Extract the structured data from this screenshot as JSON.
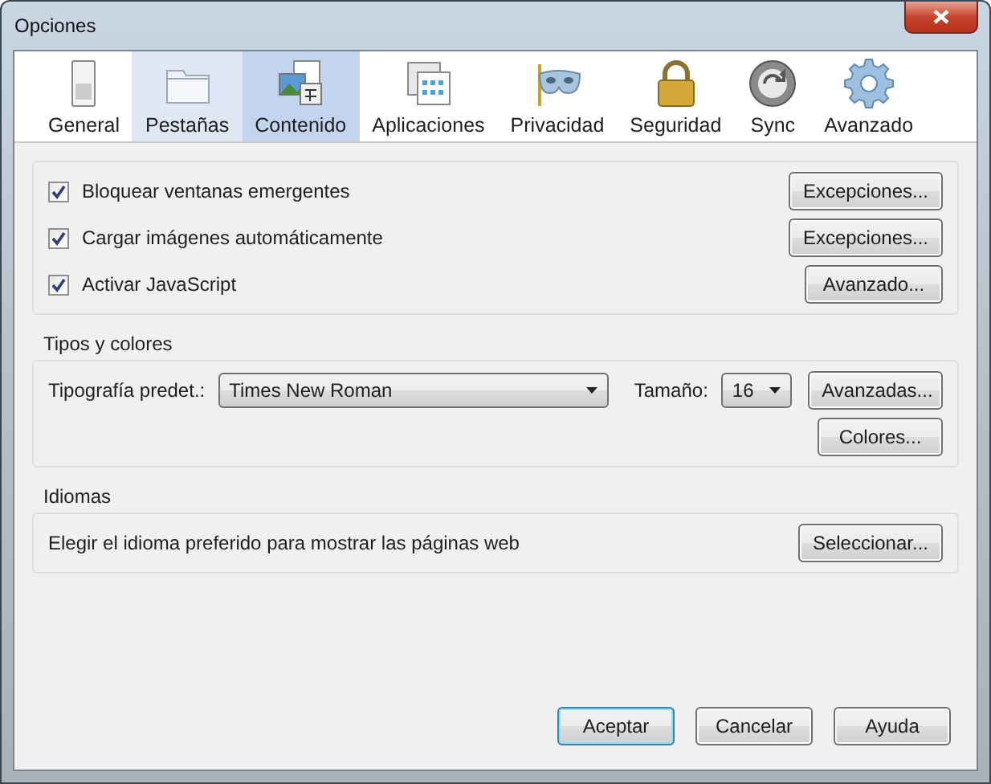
{
  "window": {
    "title": "Opciones"
  },
  "tabs": [
    {
      "label": "General",
      "kind": "switch",
      "selected": false,
      "hovered": false
    },
    {
      "label": "Pestañas",
      "kind": "tabs",
      "selected": false,
      "hovered": true
    },
    {
      "label": "Contenido",
      "kind": "content",
      "selected": true,
      "hovered": false
    },
    {
      "label": "Aplicaciones",
      "kind": "apps",
      "selected": false,
      "hovered": false
    },
    {
      "label": "Privacidad",
      "kind": "mask",
      "selected": false,
      "hovered": false
    },
    {
      "label": "Seguridad",
      "kind": "lock",
      "selected": false,
      "hovered": false
    },
    {
      "label": "Sync",
      "kind": "sync",
      "selected": false,
      "hovered": false
    },
    {
      "label": "Avanzado",
      "kind": "gear",
      "selected": false,
      "hovered": false
    }
  ],
  "content": {
    "options": [
      {
        "label": "Bloquear ventanas emergentes",
        "checked": true,
        "button": "Excepciones..."
      },
      {
        "label": "Cargar imágenes automáticamente",
        "checked": true,
        "button": "Excepciones..."
      },
      {
        "label": "Activar JavaScript",
        "checked": true,
        "button": "Avanzado..."
      }
    ]
  },
  "fonts": {
    "title": "Tipos y colores",
    "font_label": "Tipografía predet.:",
    "font_value": "Times New Roman",
    "size_label": "Tamaño:",
    "size_value": "16",
    "advanced_button": "Avanzadas...",
    "colors_button": "Colores..."
  },
  "languages": {
    "title": "Idiomas",
    "text": "Elegir el idioma preferido para mostrar las páginas web",
    "button": "Seleccionar..."
  },
  "buttons": [
    {
      "label": "Aceptar",
      "default": true
    },
    {
      "label": "Cancelar",
      "default": false
    },
    {
      "label": "Ayuda",
      "default": false
    }
  ]
}
